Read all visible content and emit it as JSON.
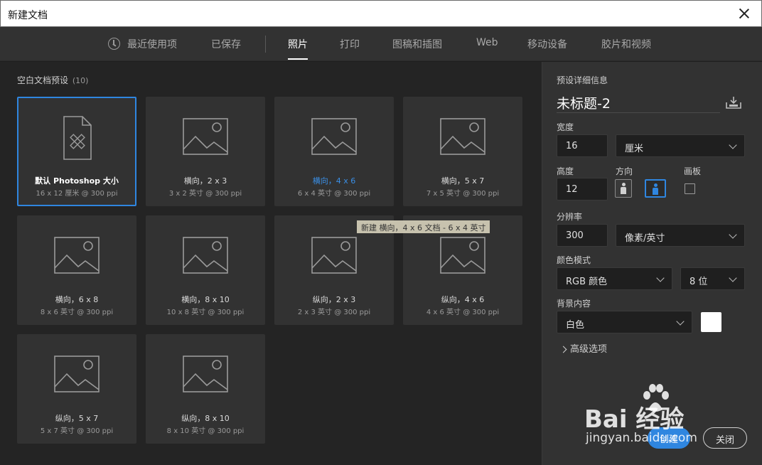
{
  "window": {
    "title": "新建文档"
  },
  "tabs": [
    {
      "label": "最近使用项",
      "icon": "clock-icon"
    },
    {
      "label": "已保存"
    },
    {
      "label": "照片",
      "active": true
    },
    {
      "label": "打印"
    },
    {
      "label": "图稿和插图"
    },
    {
      "label": "Web"
    },
    {
      "label": "移动设备"
    },
    {
      "label": "胶片和视频"
    }
  ],
  "presets": {
    "header": "空白文档预设",
    "count": "(10)",
    "cards": [
      {
        "name": "默认 Photoshop 大小",
        "desc": "16 x 12 厘米 @ 300 ppi",
        "icon": "document-ruler-pencil-icon",
        "selected": true
      },
      {
        "name": "横向，2 x 3",
        "desc": "3 x 2 英寸 @ 300 ppi",
        "icon": "image-placeholder-icon"
      },
      {
        "name": "横向，4 x 6",
        "desc": "6 x 4 英寸 @ 300 ppi",
        "icon": "image-placeholder-icon",
        "highlight": true
      },
      {
        "name": "横向，5 x 7",
        "desc": "7 x 5 英寸 @ 300 ppi",
        "icon": "image-placeholder-icon"
      },
      {
        "name": "横向，6 x 8",
        "desc": "8 x 6 英寸 @ 300 ppi",
        "icon": "image-placeholder-icon"
      },
      {
        "name": "横向，8 x 10",
        "desc": "10 x 8 英寸 @ 300 ppi",
        "icon": "image-placeholder-icon"
      },
      {
        "name": "纵向，2 x 3",
        "desc": "2 x 3 英寸 @ 300 ppi",
        "icon": "image-placeholder-icon"
      },
      {
        "name": "纵向，4 x 6",
        "desc": "4 x 6 英寸 @ 300 ppi",
        "icon": "image-placeholder-icon"
      },
      {
        "name": "纵向，5 x 7",
        "desc": "5 x 7 英寸 @ 300 ppi",
        "icon": "image-placeholder-icon"
      },
      {
        "name": "纵向，8 x 10",
        "desc": "8 x 10 英寸 @ 300 ppi",
        "icon": "image-placeholder-icon"
      }
    ],
    "tooltip": "新建 横向，4 x 6 文档 - 6 x 4 英寸"
  },
  "details": {
    "header": "预设详细信息",
    "doc_name": "未标题-2",
    "width_label": "宽度",
    "width_value": "16",
    "width_unit": "厘米",
    "height_label": "高度",
    "height_value": "12",
    "orientation_label": "方向",
    "artboard_label": "画板",
    "resolution_label": "分辨率",
    "resolution_value": "300",
    "resolution_unit": "像素/英寸",
    "color_mode_label": "颜色模式",
    "color_mode_value": "RGB 颜色",
    "bit_depth_value": "8 位",
    "background_label": "背景内容",
    "background_value": "白色",
    "background_color": "#ffffff",
    "advanced_label": "高级选项",
    "create_button": "创建",
    "close_button": "关闭"
  },
  "watermark": {
    "brand": "Bai  经验",
    "url": "jingyan.baidu.com"
  },
  "colors": {
    "accent": "#2f86e0",
    "panel": "#323232",
    "background": "#242424"
  }
}
